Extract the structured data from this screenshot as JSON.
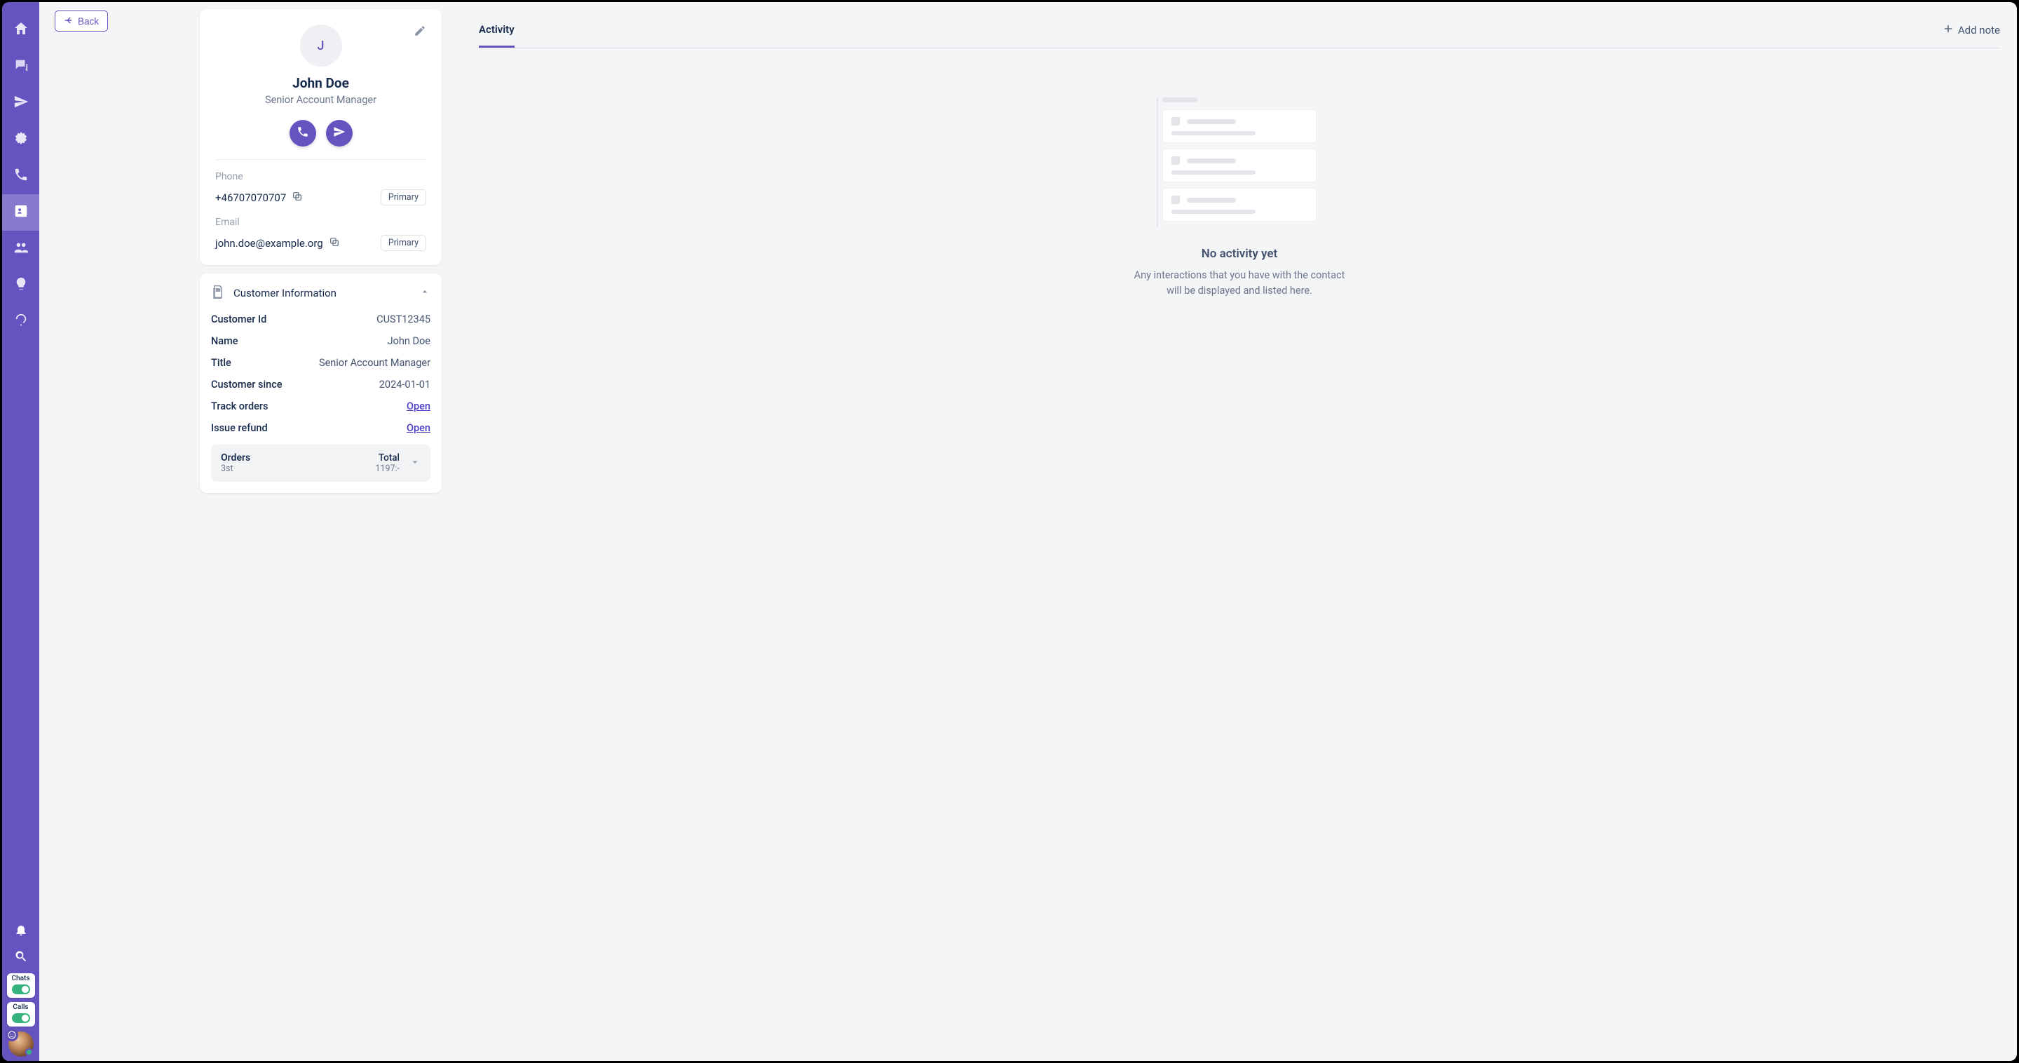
{
  "back_label": "Back",
  "sidebar": {
    "chats_label": "Chats",
    "calls_label": "Calls"
  },
  "profile": {
    "initial": "J",
    "name": "John Doe",
    "title": "Senior Account Manager",
    "phone_label": "Phone",
    "phone_value": "+46707070707",
    "phone_tag": "Primary",
    "email_label": "Email",
    "email_value": "john.doe@example.org",
    "email_tag": "Primary"
  },
  "customer_info": {
    "header": "Customer Information",
    "rows": {
      "customer_id_k": "Customer Id",
      "customer_id_v": "CUST12345",
      "name_k": "Name",
      "name_v": "John Doe",
      "title_k": "Title",
      "title_v": "Senior Account Manager",
      "since_k": "Customer since",
      "since_v": "2024-01-01",
      "track_k": "Track orders",
      "track_v": "Open",
      "refund_k": "Issue refund",
      "refund_v": "Open"
    },
    "orders": {
      "label": "Orders",
      "count": "3st",
      "total_label": "Total",
      "total_value": "1197:-"
    }
  },
  "activity": {
    "tab_label": "Activity",
    "add_note": "Add note",
    "empty_title": "No activity yet",
    "empty_sub": "Any interactions that you have with the contact will be displayed and listed here."
  }
}
